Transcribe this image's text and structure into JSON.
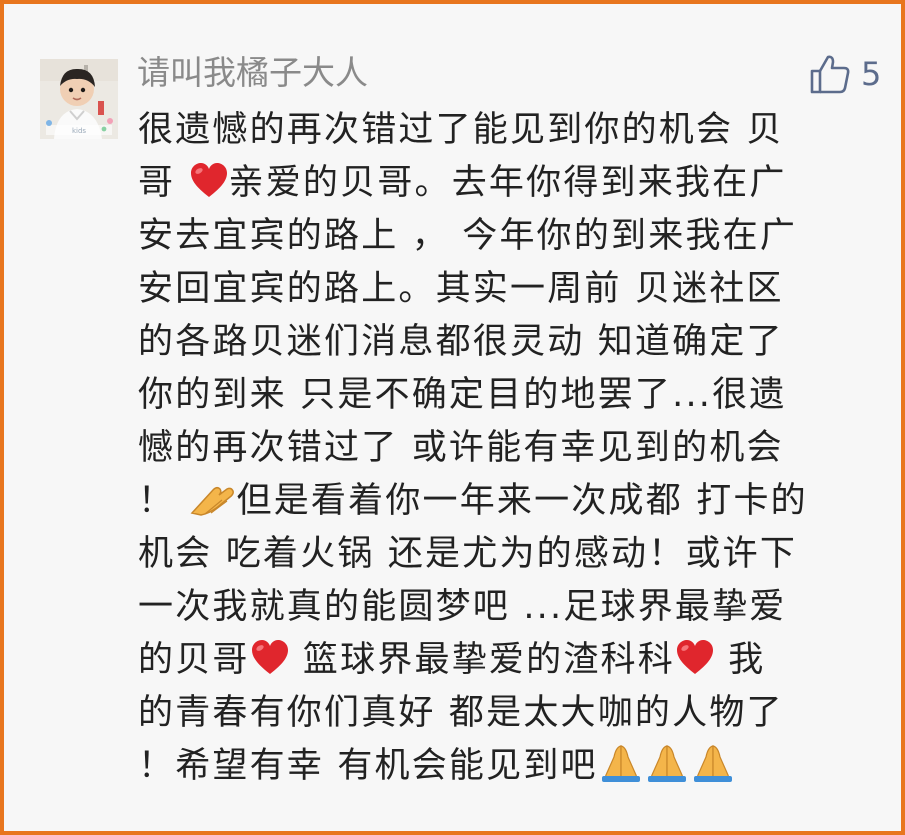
{
  "comment": {
    "username": "请叫我橘子大人",
    "like_count": "5",
    "avatar_caption": "kids",
    "accent_border_color": "#e8761e",
    "text_segments": [
      "很遗憾的再次错过了能见到你的机会 贝",
      "哥 ",
      "亲爱的贝哥。去年你得到来我在广",
      "安去宜宾的路上 ， 今年你的到来我在广",
      "安回宜宾的路上。其实一周前 贝迷社区",
      "的各路贝迷们消息都很灵动 知道确定了",
      "你的到来 只是不确定目的地罢了...很遗",
      "憾的再次错过了 或许能有幸见到的机会",
      "！ ",
      "但是看着你一年来一次成都 打卡的",
      "机会 吃着火锅 还是尤为的感动！或许下",
      "一次我就真的能圆梦吧 ...足球界最挚爱",
      "的贝哥",
      " 篮球界最挚爱的渣科科",
      " 我",
      "的青春有你们真好 都是太大咖的人物了",
      "！希望有幸 有机会能见到吧"
    ],
    "emojis": {
      "heart": "red-heart-icon",
      "clap": "clapping-hand-icon",
      "pray": "praying-hands-icon"
    }
  }
}
